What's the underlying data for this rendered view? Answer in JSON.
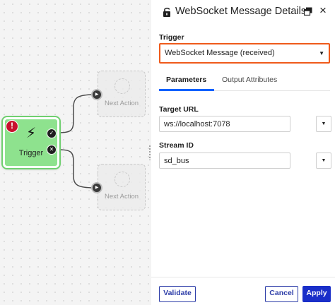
{
  "canvas": {
    "trigger_node": {
      "label": "Trigger",
      "icon": "lightning-bolt-icon",
      "bolt_glyph": "⚡",
      "color": "#8ee28e"
    },
    "error_badge": "!",
    "success_port_glyph": "✓",
    "failure_port_glyph": "✕",
    "play_glyph": "▶",
    "actions": [
      {
        "label": "Next Action"
      },
      {
        "label": "Next Action"
      }
    ]
  },
  "panel": {
    "title": "WebSocket Message Details",
    "close_glyph": "×",
    "trigger": {
      "label": "Trigger",
      "value": "WebSocket Message (received)",
      "caret": "▼",
      "highlight_color": "#ef5a1b"
    },
    "tabs": [
      {
        "label": "Parameters",
        "active": true
      },
      {
        "label": "Output Attributes",
        "active": false
      }
    ],
    "fields": {
      "target_url": {
        "label": "Target URL",
        "value": "ws://localhost:7078",
        "dropdown_glyph": "▼"
      },
      "stream_id": {
        "label": "Stream ID",
        "value": "sd_bus",
        "dropdown_glyph": "▼"
      }
    },
    "buttons": {
      "validate": "Validate",
      "cancel": "Cancel",
      "apply": "Apply"
    },
    "accent_color": "#1a2fc9"
  }
}
